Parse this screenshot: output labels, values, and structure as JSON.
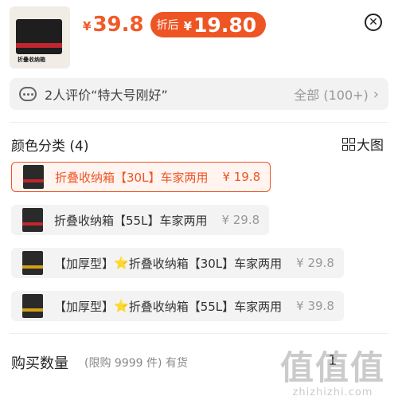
{
  "product": {
    "thumb_label": "折叠收纳箱",
    "currency": "¥",
    "price": "39.8",
    "discount_tag": "折后",
    "discount_currency": "¥",
    "discount_price": "19.80"
  },
  "close_icon": "close-icon",
  "review": {
    "text": "2人评价“特大号刚好”",
    "all_label": "全部 (100+)",
    "chevron": "›"
  },
  "colors": {
    "title": "颜色分类 (4)",
    "big_image_label": "大图",
    "options": [
      {
        "label": "折叠收纳箱【30L】车家两用",
        "price": "¥ 19.8",
        "selected": true
      },
      {
        "label": "折叠收纳箱【55L】车家两用",
        "price": "¥ 29.8",
        "selected": false
      },
      {
        "prefix": "【加厚型】",
        "star": "⭐",
        "label": "折叠收纳箱【30L】车家两用",
        "price": "¥ 29.8",
        "selected": false
      },
      {
        "prefix": "【加厚型】",
        "star": "⭐",
        "label": "折叠收纳箱【55L】车家两用",
        "price": "¥ 39.8",
        "selected": false
      }
    ]
  },
  "quantity": {
    "label": "购买数量",
    "limit_text": "(限购 9999 件) 有货",
    "value": "1"
  },
  "watermark": {
    "cn": "值值值",
    "en": "zhizhizhi.com"
  },
  "accent_color": "#ee5524"
}
